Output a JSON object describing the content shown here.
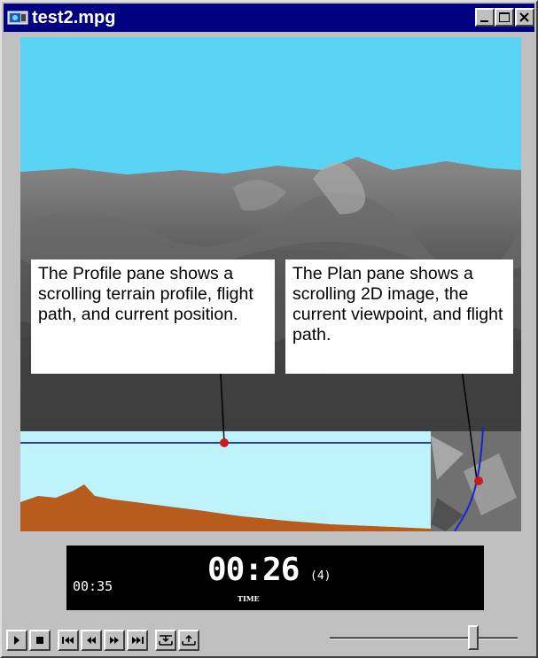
{
  "window": {
    "title": "test2.mpg"
  },
  "titlebar_buttons": {
    "minimize": "minimize-icon",
    "maximize": "maximize-icon",
    "close": "close-icon"
  },
  "callouts": {
    "profile": "The Profile pane shows a scrolling terrain profile, flight path, and current position.",
    "plan": "The Plan pane shows a scrolling 2D image, the current viewpoint, and flight path."
  },
  "display": {
    "elapsed": "00:35",
    "timecode": "00:26",
    "mode": "(4)",
    "time_label": "TIME"
  },
  "controls": {
    "buttons": [
      "play-icon",
      "stop-icon",
      "skip-back-icon",
      "rewind-icon",
      "fast-forward-icon",
      "skip-forward-icon",
      "mark-in-icon",
      "mark-out-icon"
    ],
    "position": 0.78
  },
  "colors": {
    "sky": "#5ad4f5",
    "profile_sky": "#bff3fb",
    "terrain": "#b85c1e",
    "flight_path": "#000080",
    "position_marker": "#d01818",
    "titlebar": "#000080",
    "face": "#c0c0c0"
  }
}
